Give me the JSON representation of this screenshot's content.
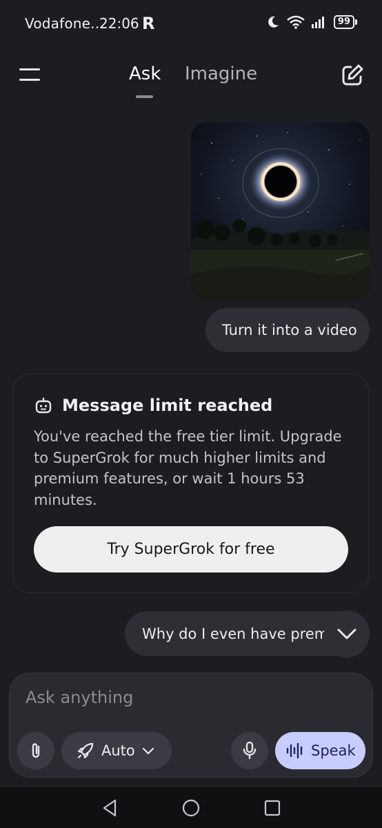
{
  "status_bar": {
    "carrier": "Vodafone...",
    "time": "22:06",
    "app_badge": "R",
    "battery": "99",
    "icons": [
      "moon-icon",
      "wifi-icon",
      "signal-icon",
      "battery-icon"
    ]
  },
  "header": {
    "tabs": [
      {
        "label": "Ask",
        "active": true
      },
      {
        "label": "Imagine",
        "active": false
      }
    ],
    "menu_icon": "hamburger-menu-icon",
    "new_chat_icon": "edit-icon"
  },
  "messages": {
    "user_image_alt": "black hole over night landscape",
    "user_text_1": "Turn it into a video",
    "user_text_2": "Why do I even have prem"
  },
  "limit_card": {
    "icon": "robot-face-icon",
    "title": "Message limit reached",
    "body": "You've reached the free tier limit. Upgrade to SuperGrok for much higher limits and premium features, or wait 1 hours 53 minutes.",
    "cta_label": "Try SuperGrok for free"
  },
  "composer": {
    "placeholder": "Ask anything",
    "mode_label": "Auto",
    "speak_label": "Speak",
    "icons": [
      "paperclip-icon",
      "rocket-icon",
      "chevron-down-icon",
      "microphone-icon",
      "waveform-icon"
    ]
  },
  "colors": {
    "background": "#1c1d21",
    "bubble": "#2e2f35",
    "cta": "#eef0ef",
    "speak_accent": "#c9ccff"
  }
}
